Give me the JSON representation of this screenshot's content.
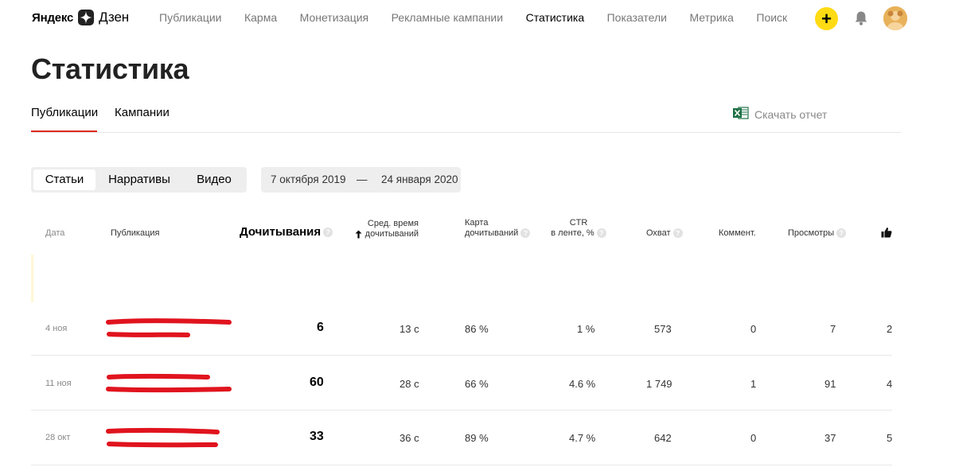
{
  "header": {
    "logo": {
      "word1": "Яндекс",
      "word2": "Дзен"
    },
    "nav": [
      {
        "label": "Публикации",
        "active": false
      },
      {
        "label": "Карма",
        "active": false
      },
      {
        "label": "Монетизация",
        "active": false
      },
      {
        "label": "Рекламные кампании",
        "active": false
      },
      {
        "label": "Статистика",
        "active": true
      },
      {
        "label": "Показатели",
        "active": false
      },
      {
        "label": "Метрика",
        "active": false
      },
      {
        "label": "Поиск",
        "active": false
      }
    ],
    "add_label": "+"
  },
  "page": {
    "title": "Статистика",
    "tabs": [
      {
        "label": "Публикации",
        "active": true
      },
      {
        "label": "Кампании",
        "active": false
      }
    ],
    "download_label": "Скачать отчет"
  },
  "filters": {
    "types": [
      {
        "label": "Статьи",
        "active": true
      },
      {
        "label": "Нарративы",
        "active": false
      },
      {
        "label": "Видео",
        "active": false
      }
    ],
    "date_from": "7 октября 2019",
    "date_sep": "—",
    "date_to": "24 января 2020"
  },
  "table": {
    "headers": {
      "date": "Дата",
      "publication": "Публикация",
      "readthroughs": "Дочитывания",
      "avg_time_1": "Сред. время",
      "avg_time_2": "дочитываний",
      "map_1": "Карта",
      "map_2": "дочитываний",
      "ctr_1": "CTR",
      "ctr_2": "в ленте, %",
      "reach": "Охват",
      "comments": "Коммент.",
      "views": "Просмотры"
    },
    "help_glyph": "?",
    "rows": [
      {
        "date": "4 ноя",
        "readthroughs": "6",
        "avg_time": "13 с",
        "map": "86 %",
        "ctr": "1 %",
        "reach": "573",
        "comments": "0",
        "views": "7",
        "likes": "2"
      },
      {
        "date": "11 ноя",
        "readthroughs": "60",
        "avg_time": "28 с",
        "map": "66 %",
        "ctr": "4.6 %",
        "reach": "1 749",
        "comments": "1",
        "views": "91",
        "likes": "4"
      },
      {
        "date": "28 окт",
        "readthroughs": "33",
        "avg_time": "36 с",
        "map": "89 %",
        "ctr": "4.7 %",
        "reach": "642",
        "comments": "0",
        "views": "37",
        "likes": "5"
      }
    ]
  },
  "colors": {
    "accent": "#ffdb13",
    "tab_underline": "#e02a20",
    "redaction": "#e0141e",
    "excel": "#1e7145"
  }
}
